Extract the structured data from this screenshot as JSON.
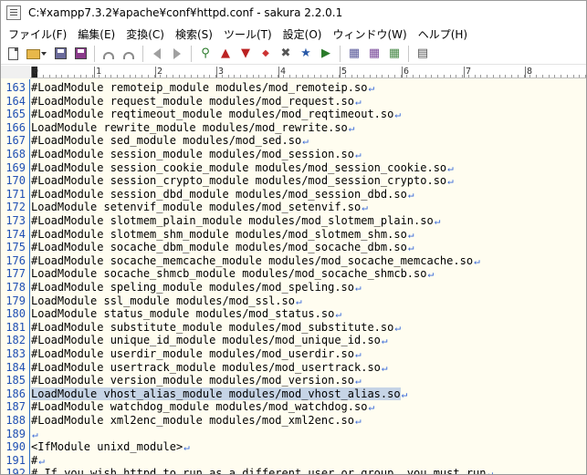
{
  "window": {
    "title": "C:¥xampp7.3.2¥apache¥conf¥httpd.conf - sakura 2.2.0.1"
  },
  "menu": [
    {
      "id": "file",
      "label": "ファイル(F)"
    },
    {
      "id": "edit",
      "label": "編集(E)"
    },
    {
      "id": "convert",
      "label": "変換(C)"
    },
    {
      "id": "search",
      "label": "検索(S)"
    },
    {
      "id": "tools",
      "label": "ツール(T)"
    },
    {
      "id": "settings",
      "label": "設定(O)"
    },
    {
      "id": "window",
      "label": "ウィンドウ(W)"
    },
    {
      "id": "help",
      "label": "ヘルプ(H)"
    }
  ],
  "toolbar": {
    "icons": [
      "new-file-icon",
      "open-file-icon",
      "save-icon",
      "save-as-icon",
      "undo-icon",
      "redo-icon",
      "jump-back-icon",
      "jump-forward-icon",
      "search-icon",
      "search-prev-icon",
      "search-next-icon",
      "replace-icon",
      "grep-icon",
      "outline-icon",
      "bookmark-icon",
      "settings-icon",
      "font-icon",
      "type-settings-icon",
      "window-list-icon"
    ]
  },
  "ruler": {
    "ticks": [
      "0",
      "1",
      "2",
      "3",
      "4",
      "5",
      "6",
      "7",
      "8"
    ]
  },
  "editor": {
    "eol_mark": "↵",
    "lines": [
      {
        "num": "163",
        "text": "#LoadModule remoteip_module modules/mod_remoteip.so"
      },
      {
        "num": "164",
        "text": "#LoadModule request_module modules/mod_request.so"
      },
      {
        "num": "165",
        "text": "#LoadModule reqtimeout_module modules/mod_reqtimeout.so"
      },
      {
        "num": "166",
        "text": "LoadModule rewrite_module modules/mod_rewrite.so"
      },
      {
        "num": "167",
        "text": "#LoadModule sed_module modules/mod_sed.so"
      },
      {
        "num": "168",
        "text": "#LoadModule session_module modules/mod_session.so"
      },
      {
        "num": "169",
        "text": "#LoadModule session_cookie_module modules/mod_session_cookie.so"
      },
      {
        "num": "170",
        "text": "#LoadModule session_crypto_module modules/mod_session_crypto.so"
      },
      {
        "num": "171",
        "text": "#LoadModule session_dbd_module modules/mod_session_dbd.so"
      },
      {
        "num": "172",
        "text": "LoadModule setenvif_module modules/mod_setenvif.so"
      },
      {
        "num": "173",
        "text": "#LoadModule slotmem_plain_module modules/mod_slotmem_plain.so"
      },
      {
        "num": "174",
        "text": "#LoadModule slotmem_shm_module modules/mod_slotmem_shm.so"
      },
      {
        "num": "175",
        "text": "#LoadModule socache_dbm_module modules/mod_socache_dbm.so"
      },
      {
        "num": "176",
        "text": "#LoadModule socache_memcache_module modules/mod_socache_memcache.so"
      },
      {
        "num": "177",
        "text": "LoadModule socache_shmcb_module modules/mod_socache_shmcb.so"
      },
      {
        "num": "178",
        "text": "#LoadModule speling_module modules/mod_speling.so"
      },
      {
        "num": "179",
        "text": "LoadModule ssl_module modules/mod_ssl.so"
      },
      {
        "num": "180",
        "text": "LoadModule status_module modules/mod_status.so"
      },
      {
        "num": "181",
        "text": "#LoadModule substitute_module modules/mod_substitute.so"
      },
      {
        "num": "182",
        "text": "#LoadModule unique_id_module modules/mod_unique_id.so"
      },
      {
        "num": "183",
        "text": "#LoadModule userdir_module modules/mod_userdir.so"
      },
      {
        "num": "184",
        "text": "#LoadModule usertrack_module modules/mod_usertrack.so"
      },
      {
        "num": "185",
        "text": "#LoadModule version_module modules/mod_version.so"
      },
      {
        "num": "186",
        "text": "LoadModule vhost_alias_module modules/mod_vhost_alias.so",
        "highlight": true
      },
      {
        "num": "187",
        "text": "#LoadModule watchdog_module modules/mod_watchdog.so"
      },
      {
        "num": "188",
        "text": "#LoadModule xml2enc_module modules/mod_xml2enc.so"
      },
      {
        "num": "189",
        "text": ""
      },
      {
        "num": "190",
        "text": "<IfModule unixd_module>"
      },
      {
        "num": "191",
        "text": "#"
      },
      {
        "num": "192",
        "text": "# If you wish httpd to run as a different user or group, you must run"
      }
    ]
  },
  "colors": {
    "line_number": "#1f4fb3",
    "eol_mark": "#3a6ad8",
    "highlight": "#c6d4e6",
    "editor_bg": "#fffdf0"
  }
}
